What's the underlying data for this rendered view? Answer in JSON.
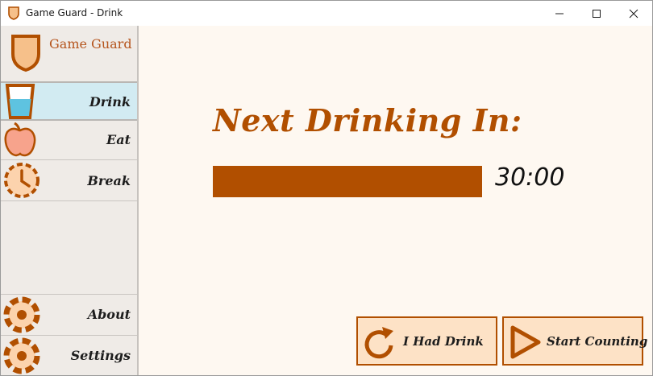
{
  "window": {
    "title": "Game Guard - Drink",
    "controls": {
      "minimize_icon": "minimize-icon",
      "maximize_icon": "maximize-icon",
      "close_icon": "close-icon"
    }
  },
  "sidebar": {
    "app_name": "Game Guard",
    "items": [
      {
        "label": "Drink",
        "icon": "glass-icon",
        "active": true
      },
      {
        "label": "Eat",
        "icon": "apple-icon",
        "active": false
      },
      {
        "label": "Break",
        "icon": "clock-icon",
        "active": false
      },
      {
        "label": "About",
        "icon": "gear-icon",
        "active": false
      },
      {
        "label": "Settings",
        "icon": "gear-icon",
        "active": false
      }
    ]
  },
  "main": {
    "heading": "Next Drinking In:",
    "timer": "30:00",
    "progress_fraction": 1.0,
    "actions": [
      {
        "label": "I Had Drink",
        "icon": "refresh-icon"
      },
      {
        "label": "Start Counting",
        "icon": "play-icon"
      }
    ]
  },
  "colors": {
    "accent": "#b14f00",
    "background": "#fef8f1",
    "sidebar": "#efebe7",
    "active_item": "#d2ebf2",
    "button_fill": "#fde2c6"
  }
}
